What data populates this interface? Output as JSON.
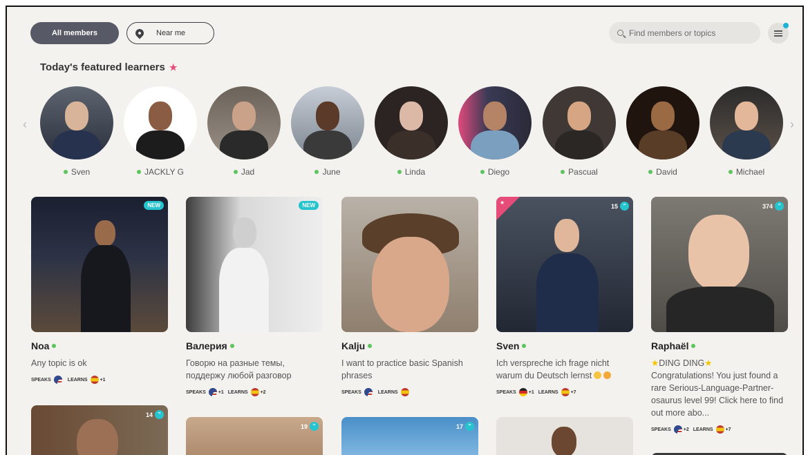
{
  "toolbar": {
    "all_members": "All members",
    "near_me": "Near me",
    "search_placeholder": "Find members or topics"
  },
  "featured": {
    "title": "Today's featured learners",
    "people": [
      {
        "name": "Sven"
      },
      {
        "name": "JACKLY G"
      },
      {
        "name": "Jad"
      },
      {
        "name": "June"
      },
      {
        "name": "Linda"
      },
      {
        "name": "Diego"
      },
      {
        "name": "Pascual"
      },
      {
        "name": "David"
      },
      {
        "name": "Michael"
      }
    ]
  },
  "cards": [
    {
      "name": "Noa",
      "badge": "NEW",
      "desc": "Any topic is ok",
      "speaks_label": "SPEAKS",
      "learns_label": "LEARNS",
      "learns_extra": "+1"
    },
    {
      "name": "Валерия",
      "badge": "NEW",
      "desc": "Говорю на разные темы, поддержу любой разговор",
      "speaks_label": "SPEAKS",
      "speaks_extra": "+1",
      "learns_label": "LEARNS",
      "learns_extra": "+2"
    },
    {
      "name": "Kalju",
      "desc": "I want to practice basic Spanish phrases",
      "speaks_label": "SPEAKS",
      "learns_label": "LEARNS"
    },
    {
      "name": "Sven",
      "count": "15",
      "desc": "Ich verspreche ich frage nicht warum du Deutsch lernst",
      "speaks_label": "SPEAKS",
      "speaks_extra": "+1",
      "learns_label": "LEARNS",
      "learns_extra": "+7"
    },
    {
      "name": "Raphaël",
      "count": "374",
      "desc_line1": "DING DING",
      "desc": "Congratulations! You just found a rare Serious-Language-Partner-osaurus level 99! Click here to find out more abo...",
      "speaks_label": "SPEAKS",
      "speaks_extra": "+2",
      "learns_label": "LEARNS",
      "learns_extra": "+7"
    }
  ],
  "row2_counts": [
    "14",
    "19",
    "17"
  ],
  "colors": {
    "accent": "#25c4cf",
    "online": "#5cc45c",
    "highlight": "#e64c78",
    "pill": "#575a66"
  }
}
